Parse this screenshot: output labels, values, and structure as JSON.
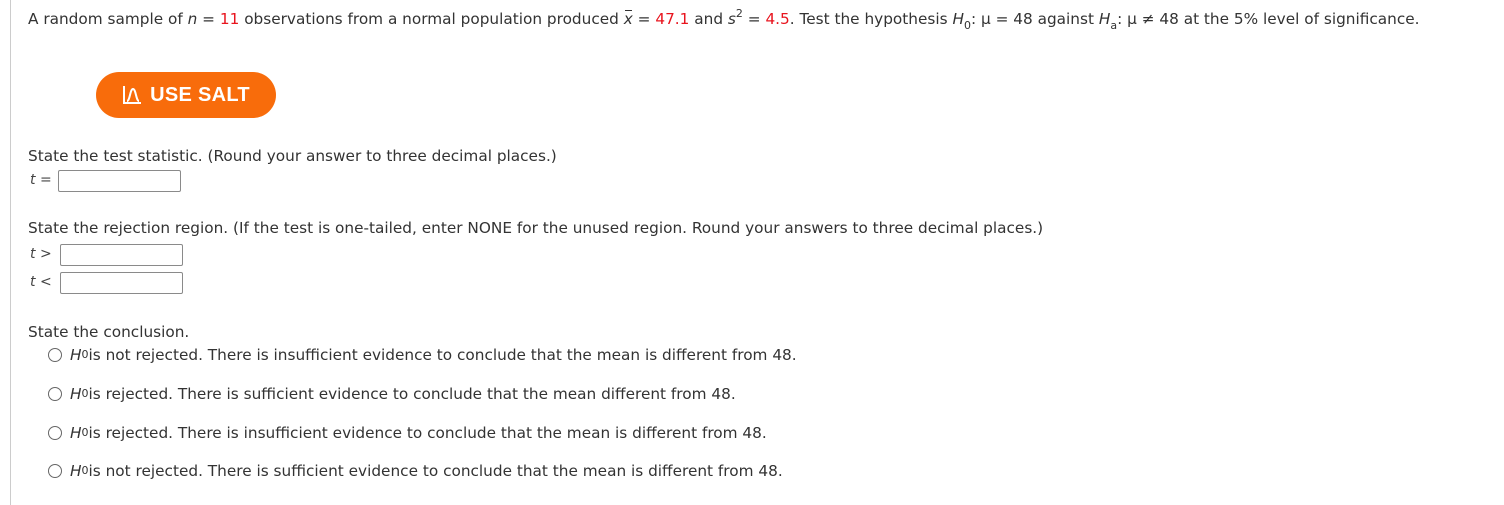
{
  "problem": {
    "part1": "A random sample of ",
    "n_var": "n",
    "eq1": " = ",
    "n_value": "11",
    "part2": " observations from a normal population produced ",
    "xbar_var": "x",
    "eq2": " = ",
    "xbar_value": "47.1",
    "part3": " and ",
    "s_var": "s",
    "s_exp": "2",
    "eq3": " = ",
    "s2_value": "4.5",
    "part4": ". Test the hypothesis ",
    "h0_var": "H",
    "h0_sub": "0",
    "h0_stmt": ": μ = 48 against ",
    "ha_var": "H",
    "ha_sub": "a",
    "ha_stmt": ": μ ≠ 48 at the 5% level of significance."
  },
  "salt_button": {
    "label": "USE SALT",
    "icon": "salt-distribution-icon",
    "color": "#f86c0b"
  },
  "test_statistic": {
    "prompt": "State the test statistic. (Round your answer to three decimal places.)",
    "label_var": "t",
    "label_op": " =",
    "value": ""
  },
  "rejection_region": {
    "prompt": "State the rejection region. (If the test is one-tailed, enter NONE for the unused region. Round your answers to three decimal places.)",
    "upper": {
      "label_var": "t",
      "label_op": " >",
      "value": ""
    },
    "lower": {
      "label_var": "t",
      "label_op": " <",
      "value": ""
    }
  },
  "conclusion": {
    "prompt": "State the conclusion.",
    "options": [
      {
        "h": "H",
        "sub": "0",
        "text": " is not rejected. There is insufficient evidence to conclude that the mean is different from 48.",
        "selected": false
      },
      {
        "h": "H",
        "sub": "0",
        "text": " is rejected. There is sufficient evidence to conclude that the mean different from 48.",
        "selected": false
      },
      {
        "h": "H",
        "sub": "0",
        "text": " is rejected. There is insufficient evidence to conclude that the mean is different from 48.",
        "selected": false
      },
      {
        "h": "H",
        "sub": "0",
        "text": " is not rejected. There is sufficient evidence to conclude that the mean is different from 48.",
        "selected": false
      }
    ]
  },
  "colors": {
    "highlight": "#e8141e",
    "text": "#333333"
  }
}
